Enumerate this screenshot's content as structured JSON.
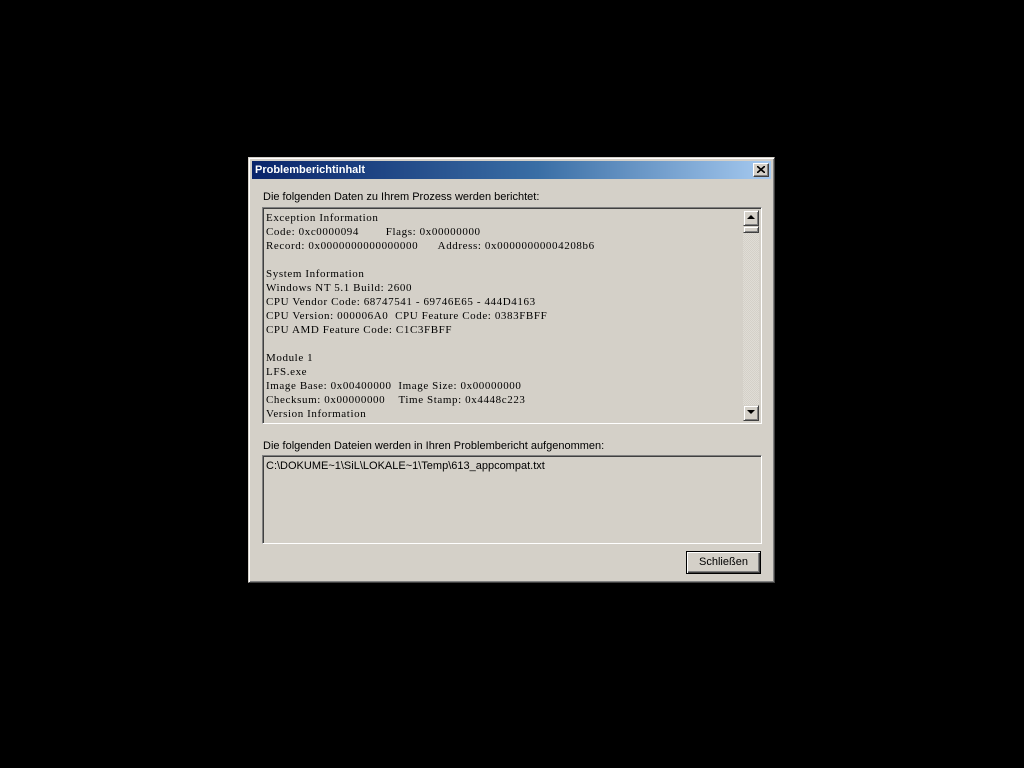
{
  "window": {
    "title": "Problemberichtinhalt",
    "close_icon": "close-x-icon"
  },
  "report": {
    "label": "Die folgenden Daten zu Ihrem Prozess werden berichtet:",
    "lines": [
      "Exception Information",
      "Code: 0xc0000094        Flags: 0x00000000",
      "Record: 0x0000000000000000      Address: 0x00000000004208b6",
      "",
      "System Information",
      "Windows NT 5.1 Build: 2600",
      "CPU Vendor Code: 68747541 - 69746E65 - 444D4163",
      "CPU Version: 000006A0  CPU Feature Code: 0383FBFF",
      "CPU AMD Feature Code: C1C3FBFF",
      "",
      "Module 1",
      "LFS.exe",
      "Image Base: 0x00400000  Image Size: 0x00000000",
      "Checksum: 0x00000000    Time Stamp: 0x4448c223",
      "Version Information"
    ]
  },
  "files": {
    "label": "Die folgenden Dateien werden in Ihren Problembericht aufgenommen:",
    "items": [
      "C:\\DOKUME~1\\SiL\\LOKALE~1\\Temp\\613_appcompat.txt"
    ]
  },
  "buttons": {
    "close_label": "Schließen"
  }
}
